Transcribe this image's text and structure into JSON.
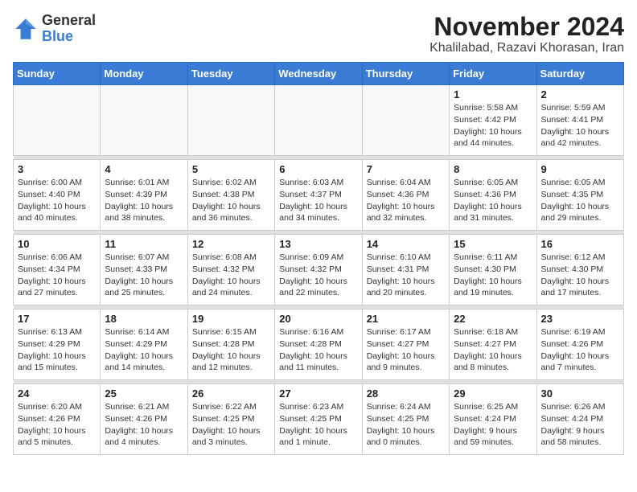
{
  "logo": {
    "general": "General",
    "blue": "Blue"
  },
  "header": {
    "month": "November 2024",
    "location": "Khalilabad, Razavi Khorasan, Iran"
  },
  "weekdays": [
    "Sunday",
    "Monday",
    "Tuesday",
    "Wednesday",
    "Thursday",
    "Friday",
    "Saturday"
  ],
  "weeks": [
    {
      "days": [
        {
          "num": "",
          "info": ""
        },
        {
          "num": "",
          "info": ""
        },
        {
          "num": "",
          "info": ""
        },
        {
          "num": "",
          "info": ""
        },
        {
          "num": "",
          "info": ""
        },
        {
          "num": "1",
          "info": "Sunrise: 5:58 AM\nSunset: 4:42 PM\nDaylight: 10 hours\nand 44 minutes."
        },
        {
          "num": "2",
          "info": "Sunrise: 5:59 AM\nSunset: 4:41 PM\nDaylight: 10 hours\nand 42 minutes."
        }
      ]
    },
    {
      "days": [
        {
          "num": "3",
          "info": "Sunrise: 6:00 AM\nSunset: 4:40 PM\nDaylight: 10 hours\nand 40 minutes."
        },
        {
          "num": "4",
          "info": "Sunrise: 6:01 AM\nSunset: 4:39 PM\nDaylight: 10 hours\nand 38 minutes."
        },
        {
          "num": "5",
          "info": "Sunrise: 6:02 AM\nSunset: 4:38 PM\nDaylight: 10 hours\nand 36 minutes."
        },
        {
          "num": "6",
          "info": "Sunrise: 6:03 AM\nSunset: 4:37 PM\nDaylight: 10 hours\nand 34 minutes."
        },
        {
          "num": "7",
          "info": "Sunrise: 6:04 AM\nSunset: 4:36 PM\nDaylight: 10 hours\nand 32 minutes."
        },
        {
          "num": "8",
          "info": "Sunrise: 6:05 AM\nSunset: 4:36 PM\nDaylight: 10 hours\nand 31 minutes."
        },
        {
          "num": "9",
          "info": "Sunrise: 6:05 AM\nSunset: 4:35 PM\nDaylight: 10 hours\nand 29 minutes."
        }
      ]
    },
    {
      "days": [
        {
          "num": "10",
          "info": "Sunrise: 6:06 AM\nSunset: 4:34 PM\nDaylight: 10 hours\nand 27 minutes."
        },
        {
          "num": "11",
          "info": "Sunrise: 6:07 AM\nSunset: 4:33 PM\nDaylight: 10 hours\nand 25 minutes."
        },
        {
          "num": "12",
          "info": "Sunrise: 6:08 AM\nSunset: 4:32 PM\nDaylight: 10 hours\nand 24 minutes."
        },
        {
          "num": "13",
          "info": "Sunrise: 6:09 AM\nSunset: 4:32 PM\nDaylight: 10 hours\nand 22 minutes."
        },
        {
          "num": "14",
          "info": "Sunrise: 6:10 AM\nSunset: 4:31 PM\nDaylight: 10 hours\nand 20 minutes."
        },
        {
          "num": "15",
          "info": "Sunrise: 6:11 AM\nSunset: 4:30 PM\nDaylight: 10 hours\nand 19 minutes."
        },
        {
          "num": "16",
          "info": "Sunrise: 6:12 AM\nSunset: 4:30 PM\nDaylight: 10 hours\nand 17 minutes."
        }
      ]
    },
    {
      "days": [
        {
          "num": "17",
          "info": "Sunrise: 6:13 AM\nSunset: 4:29 PM\nDaylight: 10 hours\nand 15 minutes."
        },
        {
          "num": "18",
          "info": "Sunrise: 6:14 AM\nSunset: 4:29 PM\nDaylight: 10 hours\nand 14 minutes."
        },
        {
          "num": "19",
          "info": "Sunrise: 6:15 AM\nSunset: 4:28 PM\nDaylight: 10 hours\nand 12 minutes."
        },
        {
          "num": "20",
          "info": "Sunrise: 6:16 AM\nSunset: 4:28 PM\nDaylight: 10 hours\nand 11 minutes."
        },
        {
          "num": "21",
          "info": "Sunrise: 6:17 AM\nSunset: 4:27 PM\nDaylight: 10 hours\nand 9 minutes."
        },
        {
          "num": "22",
          "info": "Sunrise: 6:18 AM\nSunset: 4:27 PM\nDaylight: 10 hours\nand 8 minutes."
        },
        {
          "num": "23",
          "info": "Sunrise: 6:19 AM\nSunset: 4:26 PM\nDaylight: 10 hours\nand 7 minutes."
        }
      ]
    },
    {
      "days": [
        {
          "num": "24",
          "info": "Sunrise: 6:20 AM\nSunset: 4:26 PM\nDaylight: 10 hours\nand 5 minutes."
        },
        {
          "num": "25",
          "info": "Sunrise: 6:21 AM\nSunset: 4:26 PM\nDaylight: 10 hours\nand 4 minutes."
        },
        {
          "num": "26",
          "info": "Sunrise: 6:22 AM\nSunset: 4:25 PM\nDaylight: 10 hours\nand 3 minutes."
        },
        {
          "num": "27",
          "info": "Sunrise: 6:23 AM\nSunset: 4:25 PM\nDaylight: 10 hours\nand 1 minute."
        },
        {
          "num": "28",
          "info": "Sunrise: 6:24 AM\nSunset: 4:25 PM\nDaylight: 10 hours\nand 0 minutes."
        },
        {
          "num": "29",
          "info": "Sunrise: 6:25 AM\nSunset: 4:24 PM\nDaylight: 9 hours\nand 59 minutes."
        },
        {
          "num": "30",
          "info": "Sunrise: 6:26 AM\nSunset: 4:24 PM\nDaylight: 9 hours\nand 58 minutes."
        }
      ]
    }
  ]
}
